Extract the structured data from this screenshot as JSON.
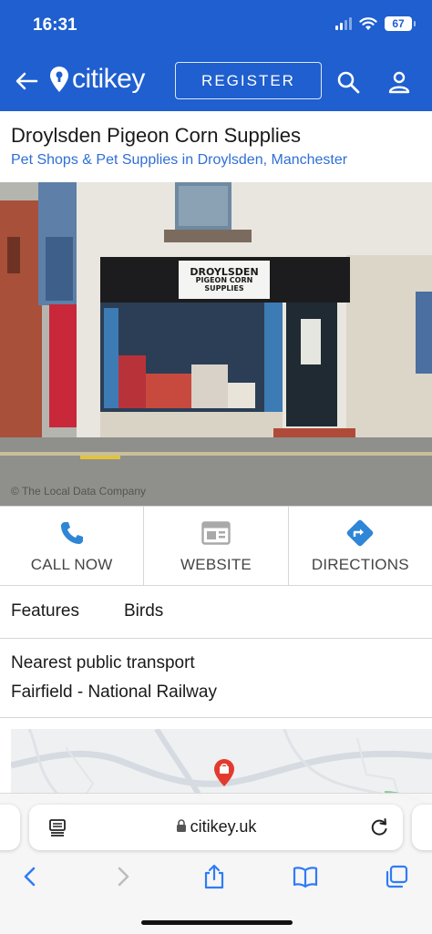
{
  "status_bar": {
    "time": "16:31",
    "battery": "67"
  },
  "header": {
    "logo_text": "citikey",
    "register_label": "REGISTER",
    "colors": {
      "brand_blue": "#1f5fcf",
      "link_blue": "#2f6fd6"
    }
  },
  "listing": {
    "title": "Droylsden Pigeon Corn Supplies",
    "category": "Pet Shops & Pet Supplies in Droylsden, Manchester",
    "photo": {
      "sign_lines": [
        "DROYLSDEN",
        "PIGEON CORN",
        "SUPPLIES"
      ],
      "credit": "© The Local Data Company"
    }
  },
  "actions": [
    {
      "label": "CALL NOW",
      "icon": "phone-icon"
    },
    {
      "label": "WEBSITE",
      "icon": "website-icon"
    },
    {
      "label": "DIRECTIONS",
      "icon": "directions-icon"
    }
  ],
  "features": {
    "label": "Features",
    "value": "Birds"
  },
  "transport": {
    "heading": "Nearest public transport",
    "value": "Fairfield - National Railway"
  },
  "browser": {
    "url": "citikey.uk"
  }
}
